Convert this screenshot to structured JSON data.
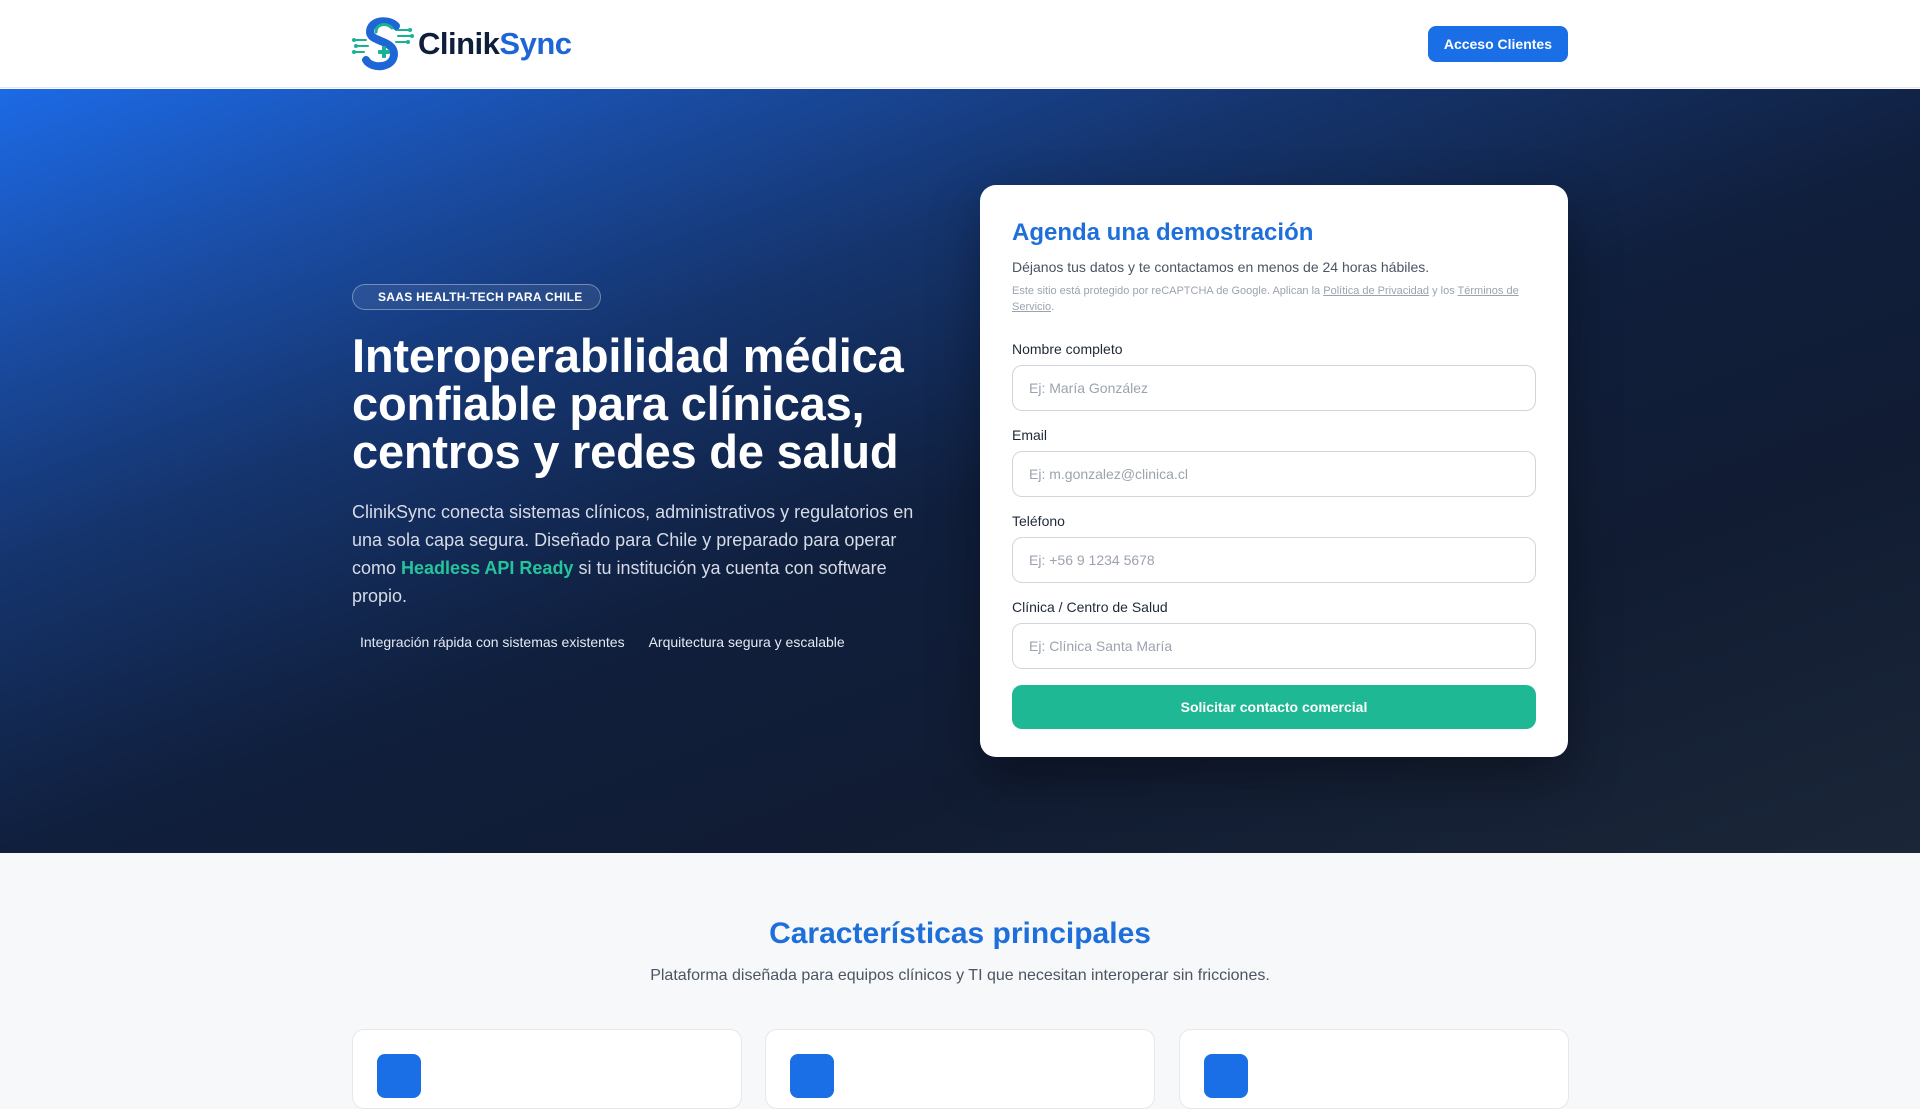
{
  "brand": {
    "logo_part1": "Clinik",
    "logo_part2": "Sync",
    "colors": {
      "primary": "#1a6fe6",
      "accent_green": "#1fb894",
      "dark": "#0f1e3a"
    }
  },
  "header": {
    "access_button": "Acceso Clientes"
  },
  "hero": {
    "badge": "SAAS HEALTH-TECH PARA CHILE",
    "title": "Interoperabilidad médica confiable para clínicas, centros y redes de salud",
    "description_before": "ClinikSync conecta sistemas clínicos, administrativos y regulatorios en una sola capa segura. Diseñado para Chile y preparado para operar como ",
    "description_accent": "Headless API Ready",
    "description_after": " si tu institución ya cuenta con software propio.",
    "feature_1": "Integración rápida con sistemas existentes",
    "feature_2": "Arquitectura segura y escalable"
  },
  "form": {
    "title": "Agenda una demostración",
    "subtitle": "Déjanos tus datos y te contactamos en menos de 24 horas hábiles.",
    "legal_before": "Este sitio está protegido por reCAPTCHA de Google. Aplican la ",
    "legal_privacy": "Política de Privacidad",
    "legal_middle": " y los ",
    "legal_terms": "Términos de Servicio",
    "legal_after": ".",
    "fields": [
      {
        "label": "Nombre completo",
        "placeholder": "Ej: María González",
        "value": ""
      },
      {
        "label": "Email",
        "placeholder": "Ej: m.gonzalez@clinica.cl",
        "value": ""
      },
      {
        "label": "Teléfono",
        "placeholder": "Ej: +56 9 1234 5678",
        "value": ""
      },
      {
        "label": "Clínica / Centro de Salud",
        "placeholder": "Ej: Clínica Santa María",
        "value": ""
      }
    ],
    "submit_label": "Solicitar contacto comercial"
  },
  "features": {
    "title": "Características principales",
    "subtitle": "Plataforma diseñada para equipos clínicos y TI que necesitan interoperar sin fricciones."
  }
}
